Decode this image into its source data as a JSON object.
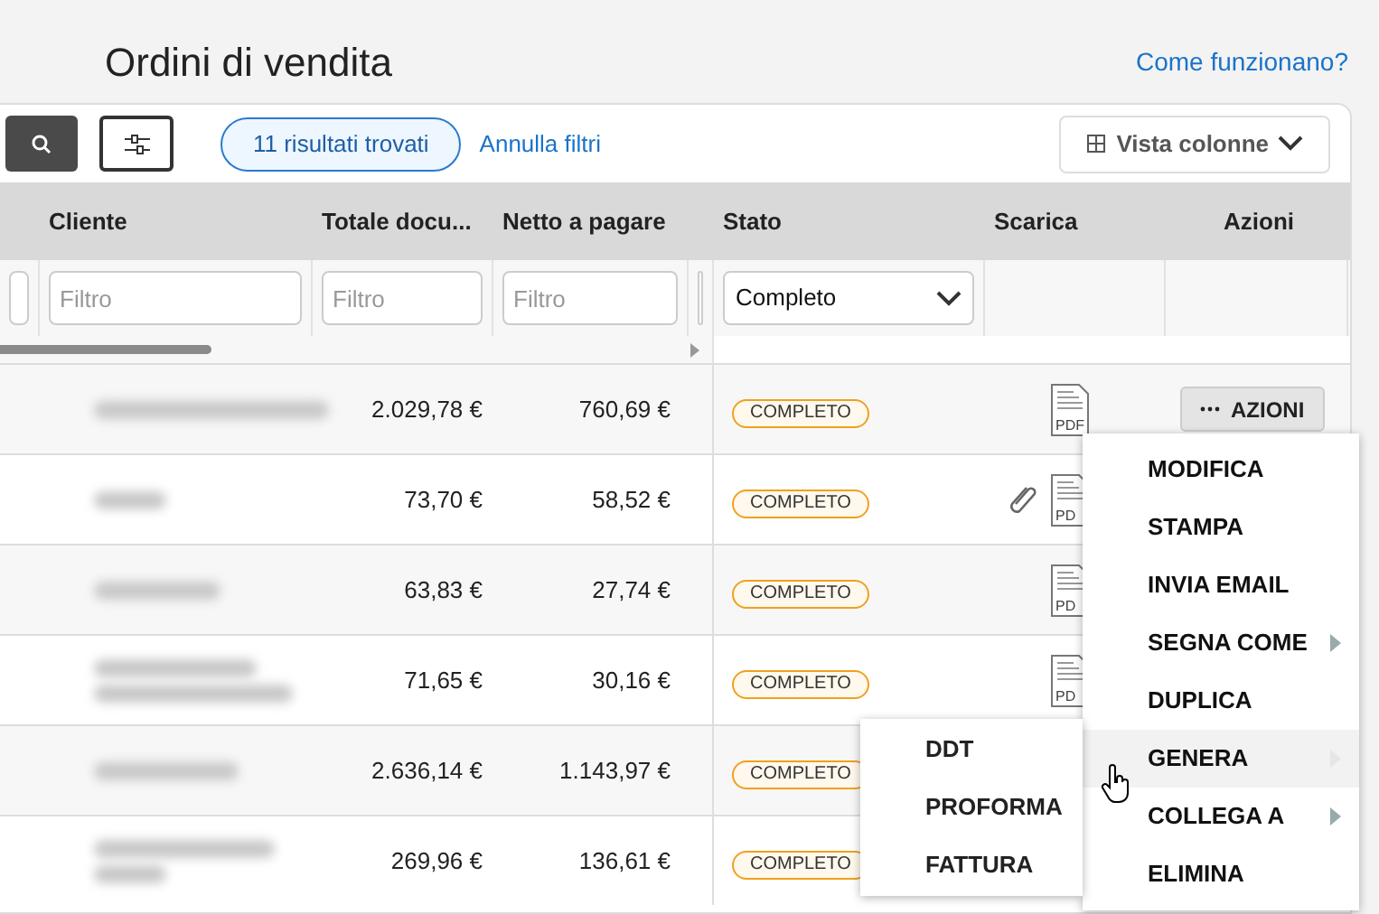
{
  "page": {
    "title": "Ordini di vendita",
    "help_link": "Come funzionano?"
  },
  "toolbar": {
    "results": "11 risultati trovati",
    "clear_filters": "Annulla filtri",
    "columns_view": "Vista colonne"
  },
  "table": {
    "columns": [
      {
        "kind": "cut"
      },
      {
        "kind": "text",
        "label": "Cliente",
        "filter": {
          "kind": "text",
          "placeholder": "Filtro"
        }
      },
      {
        "kind": "money",
        "label": "Totale docu...",
        "filter": {
          "kind": "text",
          "placeholder": "Filtro"
        }
      },
      {
        "kind": "money",
        "label": "Netto a pagare",
        "filter": {
          "kind": "text",
          "placeholder": "Filtro"
        }
      },
      {
        "kind": "cut"
      },
      {
        "kind": "status",
        "label": "Stato",
        "filter": {
          "kind": "select",
          "value": "Completo"
        }
      },
      {
        "kind": "download",
        "label": "Scarica"
      },
      {
        "kind": "actions",
        "label": "Azioni"
      }
    ],
    "rows": [
      {
        "total": "2.029,78 €",
        "net": "760,69 €",
        "status": "COMPLETO",
        "attachment": false,
        "pdf_label": "PDF",
        "actions": "AZIONI"
      },
      {
        "total": "73,70 €",
        "net": "58,52 €",
        "status": "COMPLETO",
        "attachment": true,
        "pdf_label": "PD"
      },
      {
        "total": "63,83 €",
        "net": "27,74 €",
        "status": "COMPLETO",
        "attachment": false,
        "pdf_label": "PD"
      },
      {
        "total": "71,65 €",
        "net": "30,16 €",
        "status": "COMPLETO",
        "attachment": false,
        "pdf_label": "PD"
      },
      {
        "total": "2.636,14 €",
        "net": "1.143,97 €",
        "status": "COMPLETO",
        "attachment": false
      },
      {
        "total": "269,96 €",
        "net": "136,61 €",
        "status": "COMPLETO",
        "attachment": false
      }
    ]
  },
  "actions_menu": [
    {
      "label": "MODIFICA",
      "submenu": false,
      "selected": false
    },
    {
      "label": "STAMPA",
      "submenu": false,
      "selected": false
    },
    {
      "label": "INVIA EMAIL",
      "submenu": false,
      "selected": false
    },
    {
      "label": "SEGNA COME",
      "submenu": true,
      "selected": false
    },
    {
      "label": "DUPLICA",
      "submenu": false,
      "selected": false
    },
    {
      "label": "GENERA",
      "submenu": true,
      "selected": true
    },
    {
      "label": "COLLEGA A",
      "submenu": true,
      "selected": false
    },
    {
      "label": "ELIMINA",
      "submenu": false,
      "selected": false
    }
  ],
  "generate_submenu": [
    "DDT",
    "PROFORMA",
    "FATTURA"
  ]
}
